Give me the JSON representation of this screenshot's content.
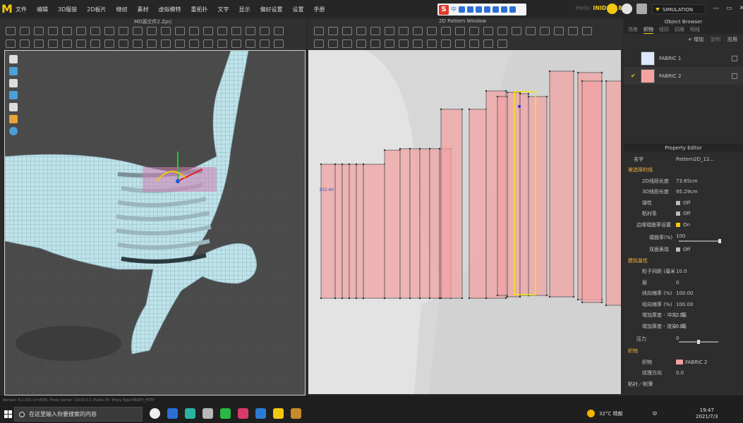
{
  "menu": [
    "文件",
    "编辑",
    "3D服装",
    "2D板片",
    "缝纫",
    "素材",
    "虚拟模特",
    "重拓扑",
    "文字",
    "显示",
    "偏好设置",
    "设置",
    "手册"
  ],
  "ime": {
    "logo": "S",
    "mode": "中"
  },
  "header": {
    "user_prefix": "Hello",
    "user": "INID2018",
    "sim_label": "SIMULATION"
  },
  "window_buttons": [
    "—",
    "▭",
    "✕"
  ],
  "panel3d": {
    "title": "MD源文件2.Zprj"
  },
  "panel2d": {
    "title": "2D Pattern Window",
    "seam_label": "102.40"
  },
  "object_browser": {
    "title": "Object Browser",
    "tabs": [
      "场景",
      "织物",
      "纽扣",
      "扣眼",
      "明线"
    ],
    "active_tab": 1,
    "actions": [
      "+ 增加",
      "复制",
      "应用"
    ],
    "fabrics": [
      {
        "name": "FABRIC 1",
        "color": "#dce8fb",
        "selected": false
      },
      {
        "name": "FABRIC 2",
        "color": "#f6a2a2",
        "selected": true
      }
    ]
  },
  "property_editor": {
    "title": "Property Editor",
    "name_label": "名字",
    "name_value": "Pattern2D_12...",
    "sec_selected": "被选择的线",
    "len2d_label": "2D线段长度",
    "len2d": "73.65cm",
    "len3d_label": "3D线段长度",
    "len3d": "95.29cm",
    "elastic_label": "弹性",
    "elastic": "Off",
    "bond_label": "粘衬条",
    "bond": "Off",
    "curv_sec": "边缘褶曲率设置",
    "curv": "On",
    "curv_rate_label": "褶曲率(%)",
    "curv_rate": "100",
    "double_label": "双面表现",
    "double": "Off",
    "sim_sec": "模拟属性",
    "particle_label": "粒子间距 (毫米",
    "particle": "10.0",
    "layer_label": "层",
    "layer": "0",
    "shrink_w_label": "纬向缩率 (%)",
    "shrink_w": "100.00",
    "shrink_h_label": "经向缩率 (%)",
    "shrink_h": "100.00",
    "thick_col_label": "增加厚度 - 冲突（毫",
    "thick_col": "2.5",
    "thick_ren_label": "增加厚度 - 渲染（毫",
    "thick_ren": "0.0",
    "pressure_label": "压力",
    "pressure": "0",
    "fabric_sec": "织物",
    "fabric_label": "织物",
    "fabric_value": "FABRIC 2",
    "grain_label": "纹理方向",
    "grain": "0.0",
    "fuse_sec": "粘衬／削薄"
  },
  "status_bar": "Version: 6.1.331 (cm408); Proxy Server: 10/10.0.1; Public IP:; Proxy Type:PROXY_HTTP",
  "taskbar": {
    "search_placeholder": "在这里输入你要搜索的内容",
    "weather": "32°C 晴朗",
    "ime": "中",
    "time": "19:47",
    "date": "2021/7/3"
  }
}
